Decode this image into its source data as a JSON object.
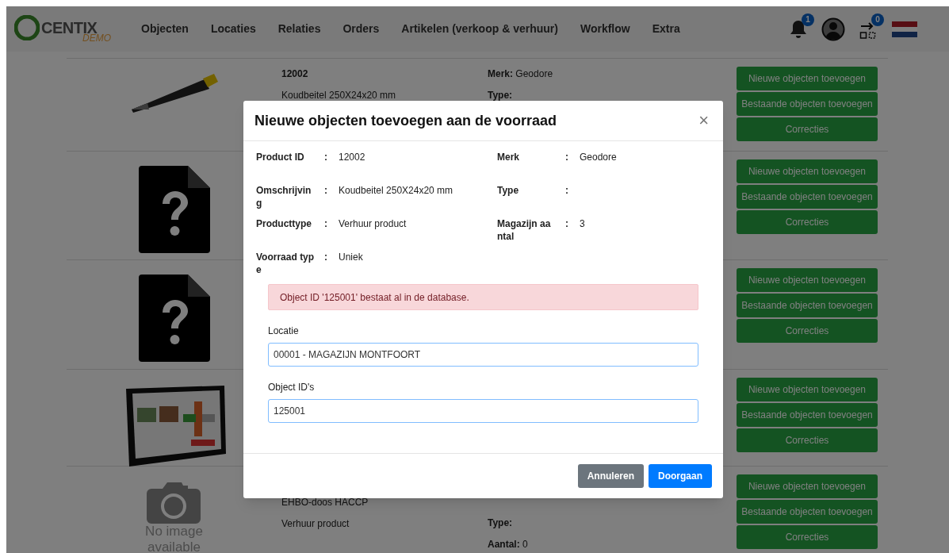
{
  "logo": {
    "name": "CENTIX",
    "tag": "DEMO"
  },
  "nav": [
    "Objecten",
    "Locaties",
    "Relaties",
    "Orders",
    "Artikelen (verkoop & verhuur)",
    "Workflow",
    "Extra"
  ],
  "header_icons": [
    {
      "kind": "bell",
      "badge": "1"
    },
    {
      "kind": "user"
    },
    {
      "kind": "transfer",
      "badge": "0"
    },
    {
      "kind": "flag"
    }
  ],
  "products": [
    {
      "kind": "chisel",
      "title": "12002",
      "description": "Koudbeitel 250X24x20 mm",
      "right": [
        {
          "label": "Merk:",
          "value": "Geodore"
        },
        {
          "label": "Type:"
        }
      ],
      "buttons": [
        "Nieuwe objecten toevoegen",
        "Bestaande objecten toevoegen",
        "Correcties"
      ]
    },
    {
      "kind": "unknown",
      "buttons": [
        "Nieuwe objecten toevoegen",
        "Bestaande objecten toevoegen",
        "Correcties"
      ]
    },
    {
      "kind": "unknown",
      "buttons": [
        "Nieuwe objecten toevoegen",
        "Bestaande objecten toevoegen",
        "Correcties"
      ]
    },
    {
      "kind": "picture",
      "buttons": [
        "Nieuwe objecten toevoegen",
        "Bestaande objecten toevoegen",
        "Correcties"
      ]
    },
    {
      "kind": "no_image",
      "image_text": [
        "No image",
        "available"
      ],
      "description": "EHBO-doos HACCP",
      "product_type": "Verhuur product",
      "right": [
        {
          "label": "Type:"
        },
        {
          "label": "Aantal:",
          "value": "0"
        }
      ],
      "buttons": [
        "Nieuwe objecten toevoegen",
        "Bestaande objecten toevoegen",
        "Correcties"
      ]
    }
  ],
  "modal": {
    "title": "Nieuwe objecten toevoegen aan de voorraad",
    "close": "×",
    "details": [
      [
        {
          "label": "Product ID",
          "sep": ":",
          "value": "12002"
        },
        {
          "label": "Merk",
          "sep": ":",
          "value": "Geodore"
        }
      ],
      [
        {
          "label": "Omschrijving",
          "sep": ":",
          "value": "Koudbeitel 250X24x20 mm"
        },
        {
          "label": "Type",
          "sep": ":"
        }
      ],
      [
        {
          "label": "Producttype",
          "sep": ":",
          "value": "Verhuur product"
        },
        {
          "label": "Magazijn aantal",
          "sep": ":",
          "value": "3"
        }
      ],
      [
        {
          "label": "Voorraad type",
          "sep": ":",
          "value": "Uniek"
        }
      ]
    ],
    "alert": "Object ID '125001' bestaat al in de database.",
    "fields": [
      {
        "label": "Locatie",
        "value": "00001 - MAGAZIJN MONTFOORT"
      },
      {
        "label": "Object ID's",
        "value": "125001"
      }
    ],
    "buttons": [
      {
        "kind": "secondary",
        "label": "Annuleren"
      },
      {
        "kind": "primary",
        "label": "Doorgaan"
      }
    ]
  }
}
